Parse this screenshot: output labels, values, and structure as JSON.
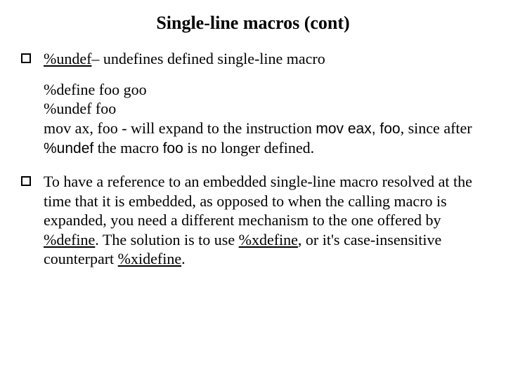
{
  "title": "Single-line macros (cont)",
  "b1": {
    "directive": "%undef",
    "rest": "– undefines defined single-line macro"
  },
  "code": {
    "l1": "%define foo goo",
    "l2": "%undef foo",
    "l3a": "mov ax, foo -   will expand to the instruction ",
    "l3b": "mov eax, foo",
    "l3c": ", since after ",
    "l3d": "%undef",
    "l3e": " the macro ",
    "l3f": "foo",
    "l3g": " is no longer defined."
  },
  "b2": {
    "t1": "To have a reference to an embedded single-line macro resolved at the time that it is embedded, as opposed to when the calling macro is expanded, you need a different mechanism to the one offered by ",
    "d1": "%define",
    "t2": ". The solution is to use ",
    "d2": "%xdefine",
    "t3": ", or it's case-insensitive counterpart ",
    "d3": "%xidefine",
    "t4": "."
  }
}
